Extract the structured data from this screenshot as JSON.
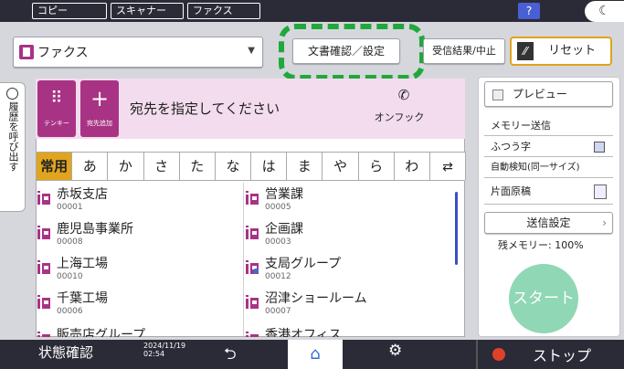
{
  "topbar": {
    "tabs": [
      "コピー",
      "スキャナー",
      "ファクス"
    ],
    "help_label": "?",
    "night_label": "☾"
  },
  "toolbar": {
    "function_label": "ファクス",
    "doc_settings_label": "文書確認／設定",
    "receive_label": "受信結果/中止",
    "reset_label": "リセット"
  },
  "history_tab": "履歴を呼び出す",
  "destination": {
    "tenkey_label": "テンキー",
    "add_label": "宛先追加",
    "prompt": "宛先を指定してください",
    "onhook_label": "オンフック"
  },
  "index_tabs": [
    "常用",
    "あ",
    "か",
    "さ",
    "た",
    "な",
    "は",
    "ま",
    "や",
    "ら",
    "わ"
  ],
  "contacts": [
    {
      "name": "赤坂支店",
      "code": "00001"
    },
    {
      "name": "営業課",
      "code": "00005"
    },
    {
      "name": "鹿児島事業所",
      "code": "00008"
    },
    {
      "name": "企画課",
      "code": "00003"
    },
    {
      "name": "上海工場",
      "code": "00010"
    },
    {
      "name": "支局グループ",
      "code": "00012"
    },
    {
      "name": "千葉工場",
      "code": "00006"
    },
    {
      "name": "沼津ショールーム",
      "code": "00007"
    },
    {
      "name": "販売店グループ",
      "code": ""
    },
    {
      "name": "香港オフィス",
      "code": ""
    }
  ],
  "right_panel": {
    "preview_label": "プレビュー",
    "memory_send": "メモリー送信",
    "normal_text": "ふつう字",
    "auto_detect": "自動検知(同一サイズ)",
    "single_side": "片面原稿",
    "send_settings": "送信設定",
    "memory_remaining": "残メモリー:  100%",
    "start_label": "スタート"
  },
  "bottombar": {
    "status_label": "状態確認",
    "date": "2024/11/19",
    "time": "02:54",
    "stop_label": "ストップ"
  },
  "colors": {
    "accent": "#a83385",
    "tab_selected": "#e1a41f",
    "highlight": "#20a83c",
    "top_bar": "#2b2b38"
  }
}
